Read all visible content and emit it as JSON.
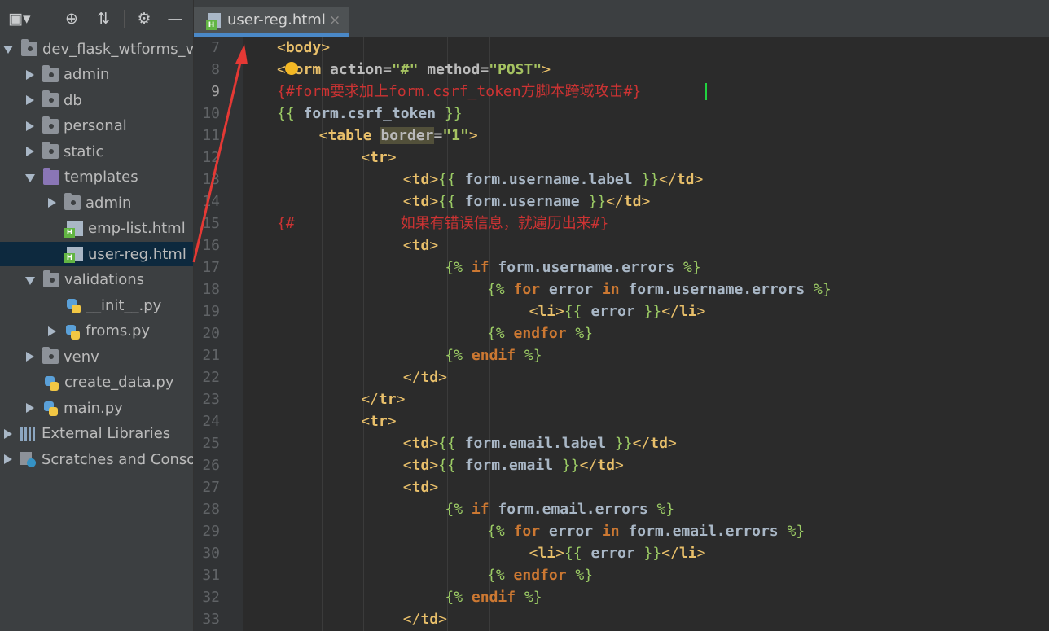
{
  "sidebar": {
    "items": [
      {
        "label": "dev_flask_wtforms_ve",
        "arrow": "down",
        "icon": "folder-icon"
      },
      {
        "label": "admin",
        "arrow": "right",
        "icon": "folder-icon"
      },
      {
        "label": "db",
        "arrow": "right",
        "icon": "folder-icon"
      },
      {
        "label": "personal",
        "arrow": "right",
        "icon": "folder-icon"
      },
      {
        "label": "static",
        "arrow": "right",
        "icon": "folder-icon"
      },
      {
        "label": "templates",
        "arrow": "down",
        "icon": "templates-folder-icon"
      },
      {
        "label": "admin",
        "arrow": "right",
        "icon": "folder-icon"
      },
      {
        "label": "emp-list.html",
        "arrow": "none",
        "icon": "html-file-icon"
      },
      {
        "label": "user-reg.html",
        "arrow": "none",
        "icon": "html-file-icon",
        "selected": true
      },
      {
        "label": "validations",
        "arrow": "down",
        "icon": "folder-icon"
      },
      {
        "label": "__init__.py",
        "arrow": "none",
        "icon": "python-file-icon"
      },
      {
        "label": "froms.py",
        "arrow": "right",
        "icon": "python-file-icon"
      },
      {
        "label": "venv",
        "arrow": "right",
        "icon": "folder-icon"
      },
      {
        "label": "create_data.py",
        "arrow": "none",
        "icon": "python-file-icon"
      },
      {
        "label": "main.py",
        "arrow": "right",
        "icon": "python-file-icon"
      },
      {
        "label": "External Libraries",
        "arrow": "right",
        "icon": "libraries-icon"
      },
      {
        "label": "Scratches and Consol",
        "arrow": "right",
        "icon": "scratches-icon"
      }
    ]
  },
  "tab": {
    "label": "user-reg.html",
    "close": "×"
  },
  "toolbar": {
    "settings_icon": "gear-icon",
    "collapse_icon": "collapse-icon",
    "locate_icon": "locate-icon",
    "hide_icon": "minus-icon"
  },
  "editor": {
    "current_line": 9,
    "lines": [
      {
        "n": "7"
      },
      {
        "n": "8"
      },
      {
        "n": "9"
      },
      {
        "n": "10"
      },
      {
        "n": "11"
      },
      {
        "n": "12"
      },
      {
        "n": "13"
      },
      {
        "n": "14"
      },
      {
        "n": "15"
      },
      {
        "n": "16"
      },
      {
        "n": "17"
      },
      {
        "n": "18"
      },
      {
        "n": "19"
      },
      {
        "n": "20"
      },
      {
        "n": "21"
      },
      {
        "n": "22"
      },
      {
        "n": "23"
      },
      {
        "n": "24"
      },
      {
        "n": "25"
      },
      {
        "n": "26"
      },
      {
        "n": "27"
      },
      {
        "n": "28"
      },
      {
        "n": "29"
      },
      {
        "n": "30"
      },
      {
        "n": "31"
      },
      {
        "n": "32"
      },
      {
        "n": "33"
      }
    ],
    "code": {
      "l7": {
        "lt": "<",
        "tag": "body",
        "gt": ">"
      },
      "l8": {
        "lt": "<",
        "tag": "form",
        "sp1": " ",
        "a1": "action",
        "eq": "=",
        "v1": "\"#\"",
        "sp2": " ",
        "a2": "method",
        "eq2": "=",
        "v2": "\"POST\"",
        "gt": ">"
      },
      "l9": {
        "text": "{#form要求加上form.csrf_token方脚本跨域攻击#}"
      },
      "l10": {
        "o": "{{ ",
        "v": "form.csrf_token",
        "c": " }}"
      },
      "l11": {
        "lt": "<",
        "tag": "table",
        "sp": " ",
        "a": "border",
        "eq": "=",
        "v": "\"1\"",
        "gt": ">"
      },
      "l12": {
        "lt": "<",
        "tag": "tr",
        "gt": ">"
      },
      "l13": {
        "lt": "<",
        "tag": "td",
        "gt": ">",
        "o": "{{ ",
        "v": "form.username.label",
        "c": " }}",
        "elt": "</",
        "etag": "td",
        "egt": ">"
      },
      "l14": {
        "lt": "<",
        "tag": "td",
        "gt": ">",
        "o": "{{ ",
        "v": "form.username",
        "c": " }}",
        "elt": "</",
        "etag": "td",
        "egt": ">"
      },
      "l15": {
        "text": "{#            如果有错误信息，就遍历出来#}"
      },
      "l16": {
        "lt": "<",
        "tag": "td",
        "gt": ">"
      },
      "l17": {
        "o": "{% ",
        "kw": "if",
        "v": " form.username.errors",
        "c": " %}"
      },
      "l18": {
        "o": "{% ",
        "kw": "for",
        "v1": " error ",
        "kw2": "in",
        "v": " form.username.errors",
        "c": " %}"
      },
      "l19": {
        "lt": "<",
        "tag": "li",
        "gt": ">",
        "o": "{{ ",
        "v": "error",
        "c": " }}",
        "elt": "</",
        "etag": "li",
        "egt": ">"
      },
      "l20": {
        "o": "{% ",
        "kw": "endfor",
        "c": " %}"
      },
      "l21": {
        "o": "{% ",
        "kw": "endif",
        "c": " %}"
      },
      "l22": {
        "elt": "</",
        "etag": "td",
        "egt": ">"
      },
      "l23": {
        "elt": "</",
        "etag": "tr",
        "egt": ">"
      },
      "l24": {
        "lt": "<",
        "tag": "tr",
        "gt": ">"
      },
      "l25": {
        "lt": "<",
        "tag": "td",
        "gt": ">",
        "o": "{{ ",
        "v": "form.email.label",
        "c": " }}",
        "elt": "</",
        "etag": "td",
        "egt": ">"
      },
      "l26": {
        "lt": "<",
        "tag": "td",
        "gt": ">",
        "o": "{{ ",
        "v": "form.email",
        "c": " }}",
        "elt": "</",
        "etag": "td",
        "egt": ">"
      },
      "l27": {
        "lt": "<",
        "tag": "td",
        "gt": ">"
      },
      "l28": {
        "o": "{% ",
        "kw": "if",
        "v": " form.email.errors",
        "c": " %}"
      },
      "l29": {
        "o": "{% ",
        "kw": "for",
        "v1": " error ",
        "kw2": "in",
        "v": " form.email.errors",
        "c": " %}"
      },
      "l30": {
        "lt": "<",
        "tag": "li",
        "gt": ">",
        "o": "{{ ",
        "v": "error",
        "c": " }}",
        "elt": "</",
        "etag": "li",
        "egt": ">"
      },
      "l31": {
        "o": "{% ",
        "kw": "endfor",
        "c": " %}"
      },
      "l32": {
        "o": "{% ",
        "kw": "endif",
        "c": " %}"
      },
      "l33": {
        "elt": "</",
        "etag": "td",
        "egt": ">"
      }
    }
  },
  "colors": {
    "annotation_arrow": "#e53935",
    "accent": "#4a88c7",
    "caret": "#21d23f"
  }
}
